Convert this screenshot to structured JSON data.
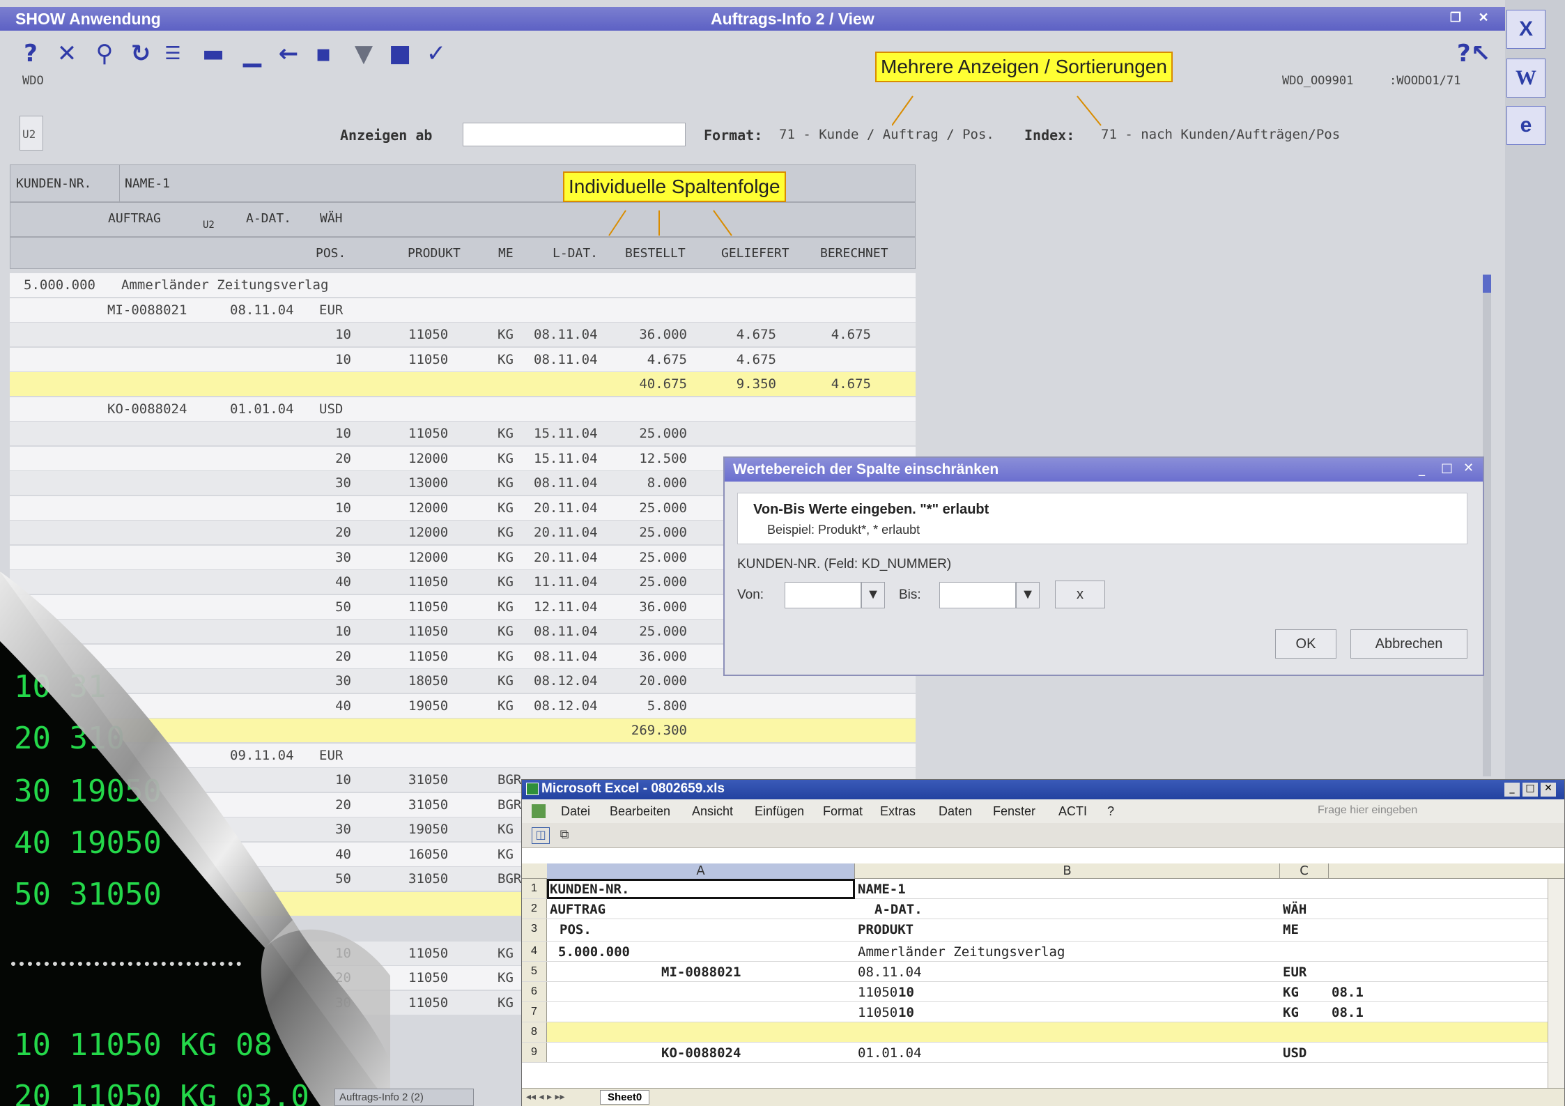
{
  "app": {
    "title": "SHOW Anwendung",
    "center_title": "Auftrags-Info 2 / View",
    "code_left": "WDO",
    "code_right_a": "WDO_OO9901",
    "code_right_b": ":WOODO1/71",
    "badge": "U2",
    "anzeigen_label": "Anzeigen ab",
    "anzeigen_value": "",
    "format_label": "Format:",
    "format_value": "71 - Kunde / Auftrag / Pos.",
    "index_label": "Index:",
    "index_value": "71 - nach Kunden/Aufträgen/Pos"
  },
  "toolbar": {
    "icons": [
      "help-icon",
      "close-icon",
      "search-icon",
      "refresh-icon",
      "list-icon",
      "minus-icon",
      "underline-icon",
      "back-arrow-icon",
      "save-icon",
      "filter-icon",
      "bookmark-icon",
      "check-icon"
    ],
    "help_right": "?↖"
  },
  "callouts": {
    "sort": "Mehrere Anzeigen / Sortierungen",
    "columns": "Individuelle Spaltenfolge"
  },
  "headers": {
    "kunden_nr": "KUNDEN-NR.",
    "name1": "NAME-1",
    "auftrag": "AUFTRAG",
    "u2": "U2",
    "a_dat": "A-DAT.",
    "waeh": "WÄH",
    "pos": "POS.",
    "produkt": "PRODUKT",
    "me": "ME",
    "l_dat": "L-DAT.",
    "bestellt": "BESTELLT",
    "geliefert": "GELIEFERT",
    "berechnet": "BERECHNET"
  },
  "grid": {
    "customer_no": "5.000.000",
    "customer_name": "Ammerländer Zeitungsverlag",
    "order1": {
      "no": "MI-0088021",
      "date": "08.11.04",
      "cur": "EUR"
    },
    "order2": {
      "no": "KO-0088024",
      "date": "01.01.04",
      "cur": "USD"
    },
    "order3": {
      "date": "09.11.04",
      "cur": "EUR"
    },
    "rows1": [
      {
        "pos": "10",
        "prod": "11050",
        "me": "KG",
        "ldat": "08.11.04",
        "best": "36.000",
        "gel": "4.675",
        "ber": "4.675"
      },
      {
        "pos": "10",
        "prod": "11050",
        "me": "KG",
        "ldat": "08.11.04",
        "best": "4.675",
        "gel": "4.675",
        "ber": ""
      }
    ],
    "sum1": {
      "best": "40.675",
      "gel": "9.350",
      "ber": "4.675"
    },
    "rows2": [
      {
        "pos": "10",
        "prod": "11050",
        "me": "KG",
        "ldat": "15.11.04",
        "best": "25.000"
      },
      {
        "pos": "20",
        "prod": "12000",
        "me": "KG",
        "ldat": "15.11.04",
        "best": "12.500"
      },
      {
        "pos": "30",
        "prod": "13000",
        "me": "KG",
        "ldat": "08.11.04",
        "best": "8.000"
      },
      {
        "pos": "10",
        "prod": "12000",
        "me": "KG",
        "ldat": "20.11.04",
        "best": "25.000"
      },
      {
        "pos": "20",
        "prod": "12000",
        "me": "KG",
        "ldat": "20.11.04",
        "best": "25.000"
      },
      {
        "pos": "30",
        "prod": "12000",
        "me": "KG",
        "ldat": "20.11.04",
        "best": "25.000"
      },
      {
        "pos": "40",
        "prod": "11050",
        "me": "KG",
        "ldat": "11.11.04",
        "best": "25.000"
      },
      {
        "pos": "50",
        "prod": "11050",
        "me": "KG",
        "ldat": "12.11.04",
        "best": "36.000"
      },
      {
        "pos": "10",
        "prod": "11050",
        "me": "KG",
        "ldat": "08.11.04",
        "best": "25.000"
      },
      {
        "pos": "20",
        "prod": "11050",
        "me": "KG",
        "ldat": "08.11.04",
        "best": "36.000"
      },
      {
        "pos": "30",
        "prod": "18050",
        "me": "KG",
        "ldat": "08.12.04",
        "best": "20.000"
      },
      {
        "pos": "40",
        "prod": "19050",
        "me": "KG",
        "ldat": "08.12.04",
        "best": "5.800"
      }
    ],
    "sum2": {
      "best": "269.300"
    },
    "rows3": [
      {
        "pos": "10",
        "prod": "31050",
        "me": "BGR"
      },
      {
        "pos": "20",
        "prod": "31050",
        "me": "BGR"
      },
      {
        "pos": "30",
        "prod": "19050",
        "me": "KG"
      },
      {
        "pos": "40",
        "prod": "16050",
        "me": "KG"
      },
      {
        "pos": "50",
        "prod": "31050",
        "me": "BGR"
      }
    ],
    "rows4": [
      {
        "pos": "10",
        "prod": "11050",
        "me": "KG"
      },
      {
        "pos": "20",
        "prod": "11050",
        "me": "KG"
      },
      {
        "pos": "30",
        "prod": "11050",
        "me": "KG"
      }
    ]
  },
  "dialog": {
    "title": "Wertebereich der Spalte einschränken",
    "line1": "Von-Bis Werte eingeben. \"*\" erlaubt",
    "line2": "Beispiel: Produkt*, * erlaubt",
    "field": "KUNDEN-NR. (Feld: KD_NUMMER)",
    "von": "Von:",
    "bis": "Bis:",
    "clear": "x",
    "ok": "OK",
    "cancel": "Abbrechen"
  },
  "excel": {
    "title": "Microsoft Excel - 0802659.xls",
    "menu": [
      "Datei",
      "Bearbeiten",
      "Ansicht",
      "Einfügen",
      "Format",
      "Extras",
      "Daten",
      "Fenster",
      "ACTI",
      "?"
    ],
    "help_placeholder": "Frage hier eingeben",
    "cols": [
      "A",
      "B",
      "C"
    ],
    "rows": [
      {
        "n": "1",
        "a": "KUNDEN-NR.",
        "b": "NAME-1",
        "c": ""
      },
      {
        "n": "2",
        "a": "AUFTRAG",
        "b": "A-DAT.",
        "c": "WÄH"
      },
      {
        "n": "3",
        "a": "POS.",
        "b": "PRODUKT",
        "c": "ME"
      },
      {
        "n": "4",
        "a": "5.000.000",
        "b": "Ammerländer Zeitungsverlag",
        "c": ""
      },
      {
        "n": "5",
        "a": "MI-0088021",
        "b": "08.11.04",
        "c": "EUR"
      },
      {
        "n": "6",
        "a": "10",
        "b": "11050",
        "c": "KG"
      },
      {
        "n": "7",
        "a": "10",
        "b": "11050",
        "c": "KG"
      },
      {
        "n": "8",
        "a": "",
        "b": "",
        "c": ""
      },
      {
        "n": "9",
        "a": "KO-0088024",
        "b": "01.01.04",
        "c": "USD"
      }
    ],
    "extra_d": "08.1",
    "sheet_tab": "Sheet0"
  },
  "terminal": {
    "lines": [
      "10 31",
      "20 310",
      "30 19050",
      "40 19050",
      "50 31050",
      "10 11050     KG  08",
      "20 11050     KG  03.0"
    ],
    "tab": "Auftrags-Info 2 (2)"
  }
}
